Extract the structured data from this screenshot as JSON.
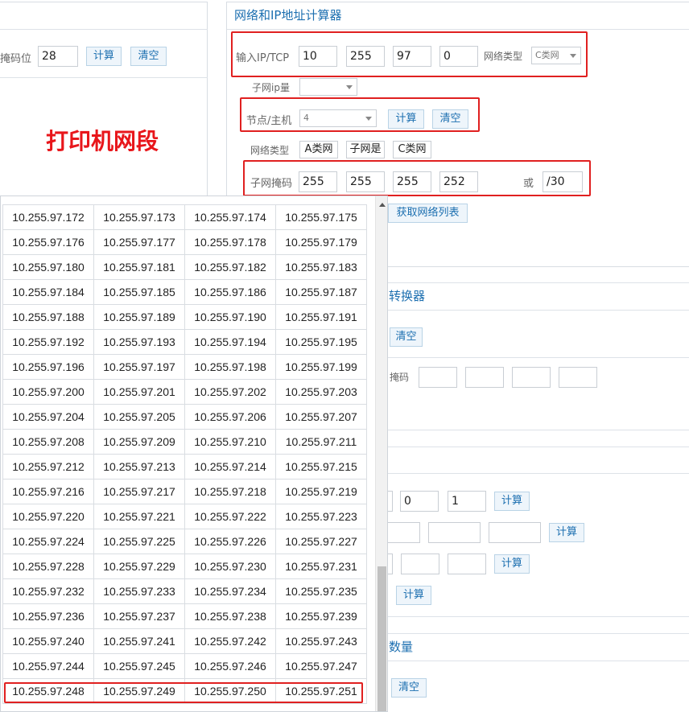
{
  "left_panel": {
    "mask_label": "掩码位",
    "mask_value": "28",
    "calc_label": "计算",
    "clear_label": "清空",
    "annotation": "打印机网段"
  },
  "calculator": {
    "title": "网络和IP地址计算器",
    "ip_label": "输入IP/TCP",
    "ip": [
      "10",
      "255",
      "97",
      "0"
    ],
    "net_type_label": "网络类型",
    "net_type_value": "C类网",
    "subnet_ip_label": "子网ip量",
    "subnet_ip_value": "",
    "nodes_label": "节点/主机",
    "nodes_value": "4",
    "calc_label": "计算",
    "clear_label": "清空",
    "result_type_label": "网络类型",
    "result_a": "A类网",
    "result_is": "子网是",
    "result_c": "C类网",
    "subnet_mask_label": "子网掩码",
    "subnet_mask": [
      "255",
      "255",
      "255",
      "252"
    ],
    "or_label": "或",
    "cidr_value": "/30",
    "get_list_label": "获取网络列表"
  },
  "converter": {
    "title_partial": "转换器",
    "clear_label": "清空",
    "mask_label_partial": "掩码",
    "fields": [
      "",
      "",
      "",
      ""
    ]
  },
  "lower_section": {
    "row1_values": [
      "0",
      "1"
    ],
    "row1_calc": "计算",
    "row2_calc": "计算",
    "row3_calc": "计算",
    "row4_calc": "计算"
  },
  "count_section": {
    "title_partial": "数量",
    "clear_label": "清空"
  },
  "ip_list": {
    "rows": [
      [
        "10.255.97.172",
        "10.255.97.173",
        "10.255.97.174",
        "10.255.97.175"
      ],
      [
        "10.255.97.176",
        "10.255.97.177",
        "10.255.97.178",
        "10.255.97.179"
      ],
      [
        "10.255.97.180",
        "10.255.97.181",
        "10.255.97.182",
        "10.255.97.183"
      ],
      [
        "10.255.97.184",
        "10.255.97.185",
        "10.255.97.186",
        "10.255.97.187"
      ],
      [
        "10.255.97.188",
        "10.255.97.189",
        "10.255.97.190",
        "10.255.97.191"
      ],
      [
        "10.255.97.192",
        "10.255.97.193",
        "10.255.97.194",
        "10.255.97.195"
      ],
      [
        "10.255.97.196",
        "10.255.97.197",
        "10.255.97.198",
        "10.255.97.199"
      ],
      [
        "10.255.97.200",
        "10.255.97.201",
        "10.255.97.202",
        "10.255.97.203"
      ],
      [
        "10.255.97.204",
        "10.255.97.205",
        "10.255.97.206",
        "10.255.97.207"
      ],
      [
        "10.255.97.208",
        "10.255.97.209",
        "10.255.97.210",
        "10.255.97.211"
      ],
      [
        "10.255.97.212",
        "10.255.97.213",
        "10.255.97.214",
        "10.255.97.215"
      ],
      [
        "10.255.97.216",
        "10.255.97.217",
        "10.255.97.218",
        "10.255.97.219"
      ],
      [
        "10.255.97.220",
        "10.255.97.221",
        "10.255.97.222",
        "10.255.97.223"
      ],
      [
        "10.255.97.224",
        "10.255.97.225",
        "10.255.97.226",
        "10.255.97.227"
      ],
      [
        "10.255.97.228",
        "10.255.97.229",
        "10.255.97.230",
        "10.255.97.231"
      ],
      [
        "10.255.97.232",
        "10.255.97.233",
        "10.255.97.234",
        "10.255.97.235"
      ],
      [
        "10.255.97.236",
        "10.255.97.237",
        "10.255.97.238",
        "10.255.97.239"
      ],
      [
        "10.255.97.240",
        "10.255.97.241",
        "10.255.97.242",
        "10.255.97.243"
      ],
      [
        "10.255.97.244",
        "10.255.97.245",
        "10.255.97.246",
        "10.255.97.247"
      ],
      [
        "10.255.97.248",
        "10.255.97.249",
        "10.255.97.250",
        "10.255.97.251"
      ]
    ],
    "highlight_row": 19
  },
  "colors": {
    "accent": "#1c6fb0",
    "highlight": "#e02020",
    "annotation": "#e8161b"
  }
}
